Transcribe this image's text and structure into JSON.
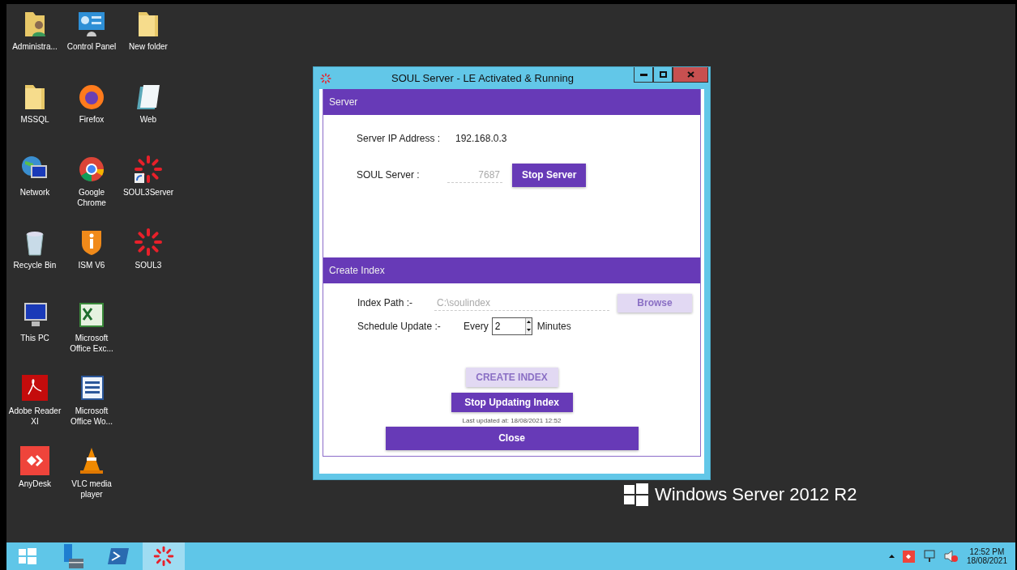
{
  "desktop": {
    "icons": [
      {
        "label": "Administra...",
        "kind": "user-folder",
        "shortcut": false
      },
      {
        "label": "MSSQL",
        "kind": "folder",
        "shortcut": false
      },
      {
        "label": "Network",
        "kind": "network",
        "shortcut": false
      },
      {
        "label": "Recycle Bin",
        "kind": "recycle",
        "shortcut": false
      },
      {
        "label": "This PC",
        "kind": "pc",
        "shortcut": false
      },
      {
        "label": "Adobe Reader XI",
        "kind": "pdf",
        "shortcut": false
      },
      {
        "label": "AnyDesk",
        "kind": "anydesk",
        "shortcut": false
      },
      {
        "label": "Control Panel",
        "kind": "control-panel",
        "shortcut": false
      },
      {
        "label": "Firefox",
        "kind": "firefox",
        "shortcut": false
      },
      {
        "label": "Google Chrome",
        "kind": "chrome",
        "shortcut": false
      },
      {
        "label": "ISM V6",
        "kind": "ism",
        "shortcut": false
      },
      {
        "label": "Microsoft Office Exc...",
        "kind": "excel",
        "shortcut": false
      },
      {
        "label": "Microsoft Office Wo...",
        "kind": "word",
        "shortcut": false
      },
      {
        "label": "VLC media player",
        "kind": "vlc",
        "shortcut": false
      },
      {
        "label": "New folder",
        "kind": "folder",
        "shortcut": false
      },
      {
        "label": "Web",
        "kind": "notepad",
        "shortcut": false
      },
      {
        "label": "SOUL3Server",
        "kind": "soul",
        "shortcut": true
      },
      {
        "label": "SOUL3",
        "kind": "soul",
        "shortcut": false
      }
    ],
    "branding": "Windows Server 2012 R2"
  },
  "window": {
    "title": "SOUL Server - LE Activated & Running",
    "server": {
      "header": "Server",
      "ip_label": "Server IP Address :",
      "ip_value": "192.168.0.3",
      "port_label": "SOUL Server :",
      "port_value": "7687",
      "port_disabled": true,
      "button": "Stop Server"
    },
    "index": {
      "header": "Create Index",
      "path_label": "Index Path :-",
      "path_value": "C:\\soulindex",
      "path_disabled": true,
      "browse": {
        "label": "Browse",
        "disabled": true
      },
      "schedule_label": "Schedule Update :-",
      "every": "Every",
      "interval": "2",
      "unit": "Minutes",
      "create": {
        "label": "CREATE INDEX",
        "disabled": true
      },
      "stop": {
        "label": "Stop Updating Index",
        "disabled": false
      },
      "last_updated": "Last updated at: 18/08/2021 12:52"
    },
    "close": "Close"
  },
  "taskbar": {
    "items": [
      {
        "kind": "start",
        "selected": false
      },
      {
        "kind": "server-manager",
        "selected": false
      },
      {
        "kind": "powershell",
        "selected": false
      },
      {
        "kind": "soul",
        "selected": true
      }
    ],
    "tray": {
      "time": "12:52 PM",
      "date": "18/08/2021"
    }
  }
}
